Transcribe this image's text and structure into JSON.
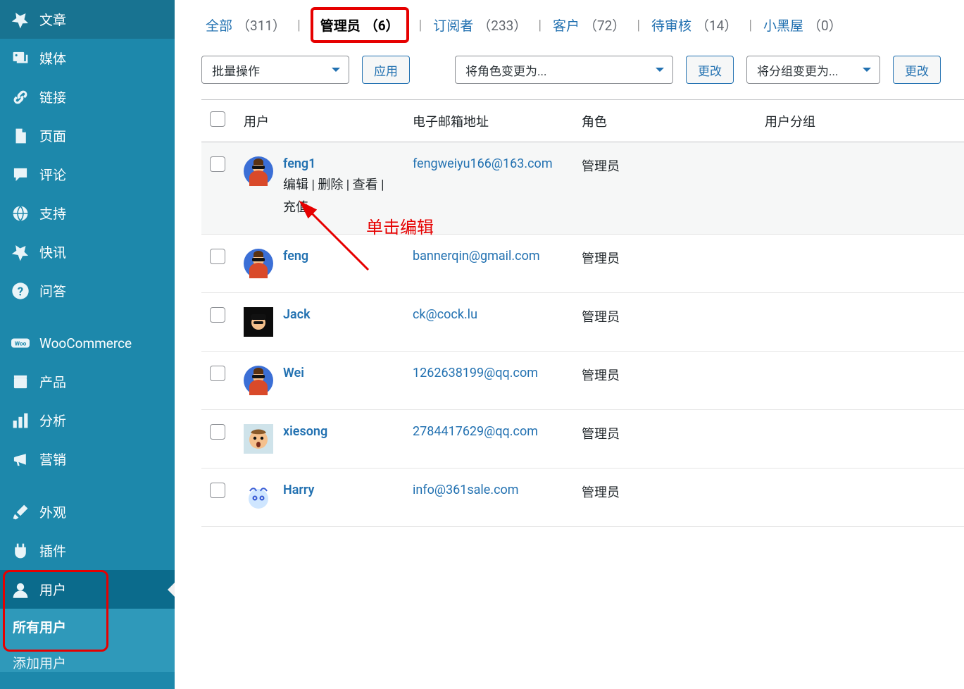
{
  "sidebar": {
    "items": [
      {
        "icon": "pin",
        "label": "文章"
      },
      {
        "icon": "media",
        "label": "媒体"
      },
      {
        "icon": "link",
        "label": "链接"
      },
      {
        "icon": "page",
        "label": "页面"
      },
      {
        "icon": "comment",
        "label": "评论"
      },
      {
        "icon": "globe",
        "label": "支持"
      },
      {
        "icon": "pin",
        "label": "快讯"
      },
      {
        "icon": "help",
        "label": "问答"
      },
      {
        "icon": "woo",
        "label": "WooCommerce"
      },
      {
        "icon": "product",
        "label": "产品"
      },
      {
        "icon": "analytics",
        "label": "分析"
      },
      {
        "icon": "marketing",
        "label": "营销"
      },
      {
        "icon": "brush",
        "label": "外观"
      },
      {
        "icon": "plugin",
        "label": "插件"
      },
      {
        "icon": "user",
        "label": "用户"
      }
    ],
    "sub": [
      {
        "label": "所有用户",
        "current": true
      },
      {
        "label": "添加用户",
        "current": false
      }
    ]
  },
  "filterTabs": [
    {
      "label": "全部",
      "count": "（311）",
      "active": false,
      "box": false
    },
    {
      "label": "管理员",
      "count": "（6）",
      "active": true,
      "box": true
    },
    {
      "label": "订阅者",
      "count": "（233）",
      "active": false,
      "box": false
    },
    {
      "label": "客户",
      "count": "（72）",
      "active": false,
      "box": false
    },
    {
      "label": "待审核",
      "count": "（14）",
      "active": false,
      "box": false
    },
    {
      "label": "小黑屋",
      "count": "（0）",
      "active": false,
      "box": false
    }
  ],
  "toolbar": {
    "bulk": "批量操作",
    "apply": "应用",
    "changeRole": "将角色变更为...",
    "changeBtn": "更改",
    "changeGroup": "将分组变更为...",
    "changeBtn2": "更改"
  },
  "columns": {
    "user": "用户",
    "email": "电子邮箱地址",
    "role": "角色",
    "group": "用户分组"
  },
  "rowActions": {
    "edit": "编辑",
    "delete": "删除",
    "view": "查看",
    "recharge": "充值"
  },
  "users": [
    {
      "name": "feng1",
      "email": "fengweiyu166@163.com",
      "role": "管理员",
      "avatarType": "a1",
      "showActions": true
    },
    {
      "name": "feng",
      "email": "bannerqin@gmail.com",
      "role": "管理员",
      "avatarType": "a1",
      "showActions": false
    },
    {
      "name": "Jack",
      "email": "ck@cock.lu",
      "role": "管理员",
      "avatarType": "a2",
      "showActions": false
    },
    {
      "name": "Wei",
      "email": "1262638199@qq.com",
      "role": "管理员",
      "avatarType": "a1",
      "showActions": false
    },
    {
      "name": "xiesong",
      "email": "2784417629@qq.com",
      "role": "管理员",
      "avatarType": "a3",
      "showActions": false
    },
    {
      "name": "Harry",
      "email": "info@361sale.com",
      "role": "管理员",
      "avatarType": "a4",
      "showActions": false
    }
  ],
  "annotation": {
    "text": "单击编辑"
  }
}
